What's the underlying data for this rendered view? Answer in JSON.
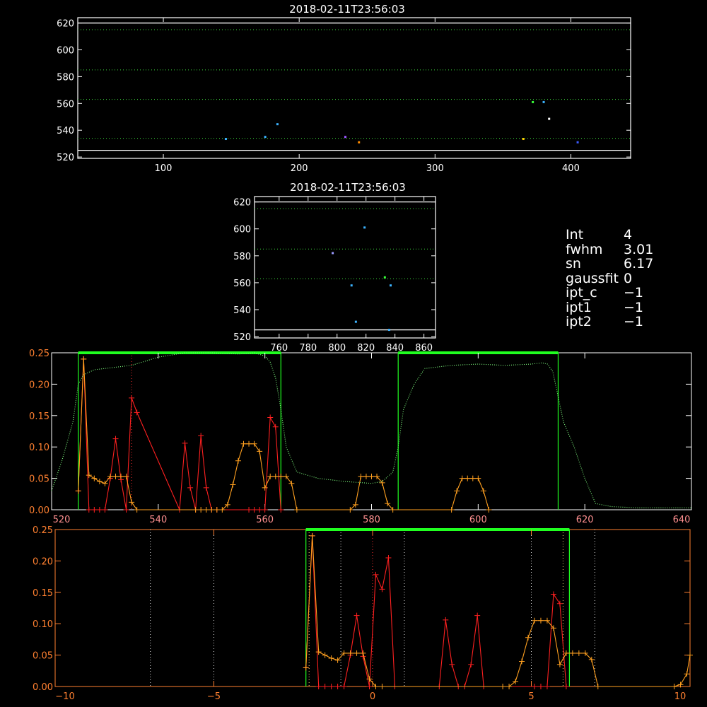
{
  "panel1": {
    "title": "2018-02-11T23:56:03",
    "xlim": [
      37,
      444
    ],
    "ylim": [
      519,
      624
    ],
    "xticks": [
      100,
      200,
      300,
      400
    ],
    "yticks": [
      520,
      540,
      560,
      580,
      600,
      620
    ],
    "hlines_white": [
      525,
      620
    ],
    "hlines_green": [
      534,
      563,
      585,
      615
    ],
    "points": [
      {
        "x": 146,
        "y": 533.5,
        "color": "#3cb3ff"
      },
      {
        "x": 175,
        "y": 535,
        "color": "#3cb3ff"
      },
      {
        "x": 184,
        "y": 544.5,
        "color": "#3cb3ff"
      },
      {
        "x": 234,
        "y": 535,
        "color": "#9b59ff"
      },
      {
        "x": 244,
        "y": 531,
        "color": "#ff8c00"
      },
      {
        "x": 365,
        "y": 533.5,
        "color": "#ffcc00"
      },
      {
        "x": 372,
        "y": 561,
        "color": "#39ff39"
      },
      {
        "x": 380,
        "y": 561,
        "color": "#3cb3ff"
      },
      {
        "x": 384,
        "y": 548.5,
        "color": "#ffffff"
      },
      {
        "x": 405,
        "y": 531,
        "color": "#3c5cff"
      }
    ]
  },
  "panel2": {
    "title": "2018-02-11T23:56:03",
    "xlim": [
      743,
      868
    ],
    "ylim": [
      519,
      624
    ],
    "xticks": [
      760,
      780,
      800,
      820,
      840,
      860
    ],
    "yticks": [
      520,
      540,
      560,
      580,
      600,
      620
    ],
    "hlines_white": [
      525,
      620
    ],
    "hlines_green": [
      563,
      585,
      615
    ],
    "points": [
      {
        "x": 797,
        "y": 582,
        "color": "#9b9bff"
      },
      {
        "x": 810,
        "y": 558,
        "color": "#3cb3ff"
      },
      {
        "x": 813,
        "y": 531,
        "color": "#3cb3ff"
      },
      {
        "x": 819,
        "y": 601,
        "color": "#3cb3ff"
      },
      {
        "x": 833,
        "y": 564,
        "color": "#39ff39"
      },
      {
        "x": 836,
        "y": 525,
        "color": "#3cb3ff"
      },
      {
        "x": 837,
        "y": 558,
        "color": "#3cb3ff"
      }
    ]
  },
  "info": [
    {
      "label": "Int",
      "value": "4"
    },
    {
      "label": "fwhm",
      "value": "3.01"
    },
    {
      "label": "sn",
      "value": "6.17"
    },
    {
      "label": "gaussfit",
      "value": "0"
    },
    {
      "label": "ipt_c",
      "value": "−1"
    },
    {
      "label": "ipt1",
      "value": "−1"
    },
    {
      "label": "ipt2",
      "value": "−1"
    }
  ],
  "chart_data": [
    {
      "type": "line",
      "xlim": [
        520,
        640
      ],
      "ylim": [
        0,
        0.25
      ],
      "xticks": [
        520,
        540,
        560,
        580,
        600,
        620,
        640
      ],
      "yticks": [
        0.0,
        0.05,
        0.1,
        0.15,
        0.2,
        0.25
      ],
      "ytick_labels": [
        "0.00",
        "0.05",
        "0.10",
        "0.15",
        "0.20",
        "0.25"
      ],
      "green_boxes": [
        [
          525,
          563
        ],
        [
          585,
          615
        ]
      ],
      "box_top": 0.25,
      "red_vline": 535,
      "series": [
        {
          "color": "#ff2020",
          "marker": "+",
          "x": [
            525,
            526,
            527,
            528,
            529,
            530,
            531,
            532,
            533,
            534,
            535,
            536,
            544,
            545,
            546,
            547,
            548,
            549,
            550,
            551,
            557,
            558,
            559,
            560,
            561,
            562,
            563
          ],
          "y": [
            0.03,
            0.24,
            0.0,
            0.0,
            0.0,
            0.0,
            0.05,
            0.113,
            0.048,
            0.0,
            0.178,
            0.155,
            0.0,
            0.106,
            0.035,
            0.0,
            0.118,
            0.035,
            0.0,
            0.0,
            0.0,
            0.0,
            0.0,
            0.0,
            0.147,
            0.132,
            0.0
          ]
        },
        {
          "color": "#ffa020",
          "marker": "+",
          "x": [
            525,
            526,
            527,
            528,
            529,
            530,
            531,
            532,
            533,
            534,
            535,
            536,
            547,
            548,
            549,
            550,
            551,
            552,
            553,
            554,
            555,
            556,
            557,
            558,
            559,
            560,
            561,
            562,
            563,
            564,
            565,
            566,
            576,
            577,
            578,
            579,
            580,
            581,
            582,
            583,
            584,
            595,
            596,
            597,
            598,
            599,
            600,
            601,
            602
          ],
          "y": [
            0.03,
            0.24,
            0.055,
            0.05,
            0.045,
            0.042,
            0.053,
            0.053,
            0.053,
            0.053,
            0.012,
            0.0,
            0.0,
            0.0,
            0.0,
            0.0,
            0.0,
            0.0,
            0.008,
            0.04,
            0.078,
            0.105,
            0.105,
            0.105,
            0.093,
            0.035,
            0.053,
            0.053,
            0.053,
            0.053,
            0.042,
            0.0,
            0.0,
            0.008,
            0.053,
            0.053,
            0.053,
            0.053,
            0.043,
            0.01,
            0.0,
            0.0,
            0.03,
            0.05,
            0.05,
            0.05,
            0.05,
            0.03,
            0.0
          ]
        },
        {
          "color": "#80ff80",
          "dotted": true,
          "x": [
            520,
            522,
            524,
            525,
            526,
            528,
            530,
            535,
            540,
            545,
            550,
            555,
            558,
            560,
            561,
            562,
            563,
            564,
            566,
            570,
            575,
            580,
            582,
            584,
            585,
            586,
            588,
            590,
            595,
            600,
            605,
            610,
            612,
            613,
            614,
            615,
            616,
            618,
            620,
            622,
            625,
            630,
            640
          ],
          "y": [
            0.03,
            0.08,
            0.14,
            0.2,
            0.215,
            0.223,
            0.225,
            0.23,
            0.243,
            0.25,
            0.25,
            0.248,
            0.25,
            0.245,
            0.235,
            0.21,
            0.16,
            0.1,
            0.06,
            0.05,
            0.045,
            0.042,
            0.045,
            0.06,
            0.1,
            0.16,
            0.2,
            0.225,
            0.23,
            0.232,
            0.23,
            0.232,
            0.234,
            0.232,
            0.22,
            0.18,
            0.14,
            0.1,
            0.05,
            0.01,
            0.005,
            0.003,
            0.003
          ]
        }
      ]
    },
    {
      "type": "line",
      "xlim": [
        -10,
        10
      ],
      "ylim": [
        0,
        0.25
      ],
      "xticks": [
        -10,
        -5,
        0,
        5,
        10
      ],
      "xtick_labels": [
        "−10",
        "−5",
        "0",
        "5",
        "10"
      ],
      "yticks": [
        0.0,
        0.05,
        0.1,
        0.15,
        0.2,
        0.25
      ],
      "ytick_labels": [
        "0.00",
        "0.05",
        "0.10",
        "0.15",
        "0.20",
        "0.25"
      ],
      "green_box": [
        -2.1,
        6.2
      ],
      "box_top": 0.25,
      "red_vline": 0,
      "dotted_vlines_white": [
        -7,
        -5,
        -1,
        1,
        5,
        7
      ],
      "dotted_vlines_yellow": [
        -2,
        0,
        6
      ],
      "series": [
        {
          "color": "#ff2020",
          "marker": "+",
          "x": [
            -2.1,
            -1.9,
            -1.7,
            -1.5,
            -1.3,
            -1.1,
            -0.9,
            -0.7,
            -0.5,
            -0.3,
            -0.1,
            0.1,
            0.3,
            0.5,
            0.7,
            2.1,
            2.3,
            2.5,
            2.7,
            2.9,
            3.1,
            3.3,
            3.5,
            5.1,
            5.3,
            5.5,
            5.7,
            5.9,
            6.1
          ],
          "y": [
            0.03,
            0.24,
            0.0,
            0.0,
            0.0,
            0.0,
            0.0,
            0.05,
            0.113,
            0.048,
            0.0,
            0.178,
            0.155,
            0.205,
            0.0,
            0.0,
            0.106,
            0.035,
            0.0,
            0.0,
            0.035,
            0.113,
            0.0,
            0.0,
            0.0,
            0.0,
            0.147,
            0.132,
            0.0
          ]
        },
        {
          "color": "#ffa020",
          "marker": "+",
          "x": [
            -2.1,
            -1.9,
            -1.7,
            -1.5,
            -1.3,
            -1.1,
            -0.9,
            -0.7,
            -0.5,
            -0.3,
            -0.1,
            0.1,
            0.3,
            4.1,
            4.3,
            4.5,
            4.7,
            4.9,
            5.1,
            5.3,
            5.5,
            5.7,
            5.9,
            6.1,
            6.3,
            6.5,
            6.7,
            6.9,
            7.1,
            9.5,
            9.7,
            9.9,
            10
          ],
          "y": [
            0.03,
            0.24,
            0.055,
            0.05,
            0.045,
            0.042,
            0.053,
            0.053,
            0.053,
            0.053,
            0.012,
            0.0,
            0.0,
            0.0,
            0.0,
            0.008,
            0.04,
            0.078,
            0.105,
            0.105,
            0.105,
            0.093,
            0.035,
            0.053,
            0.053,
            0.053,
            0.053,
            0.043,
            0.0,
            0.0,
            0.003,
            0.02,
            0.05
          ]
        }
      ]
    }
  ]
}
